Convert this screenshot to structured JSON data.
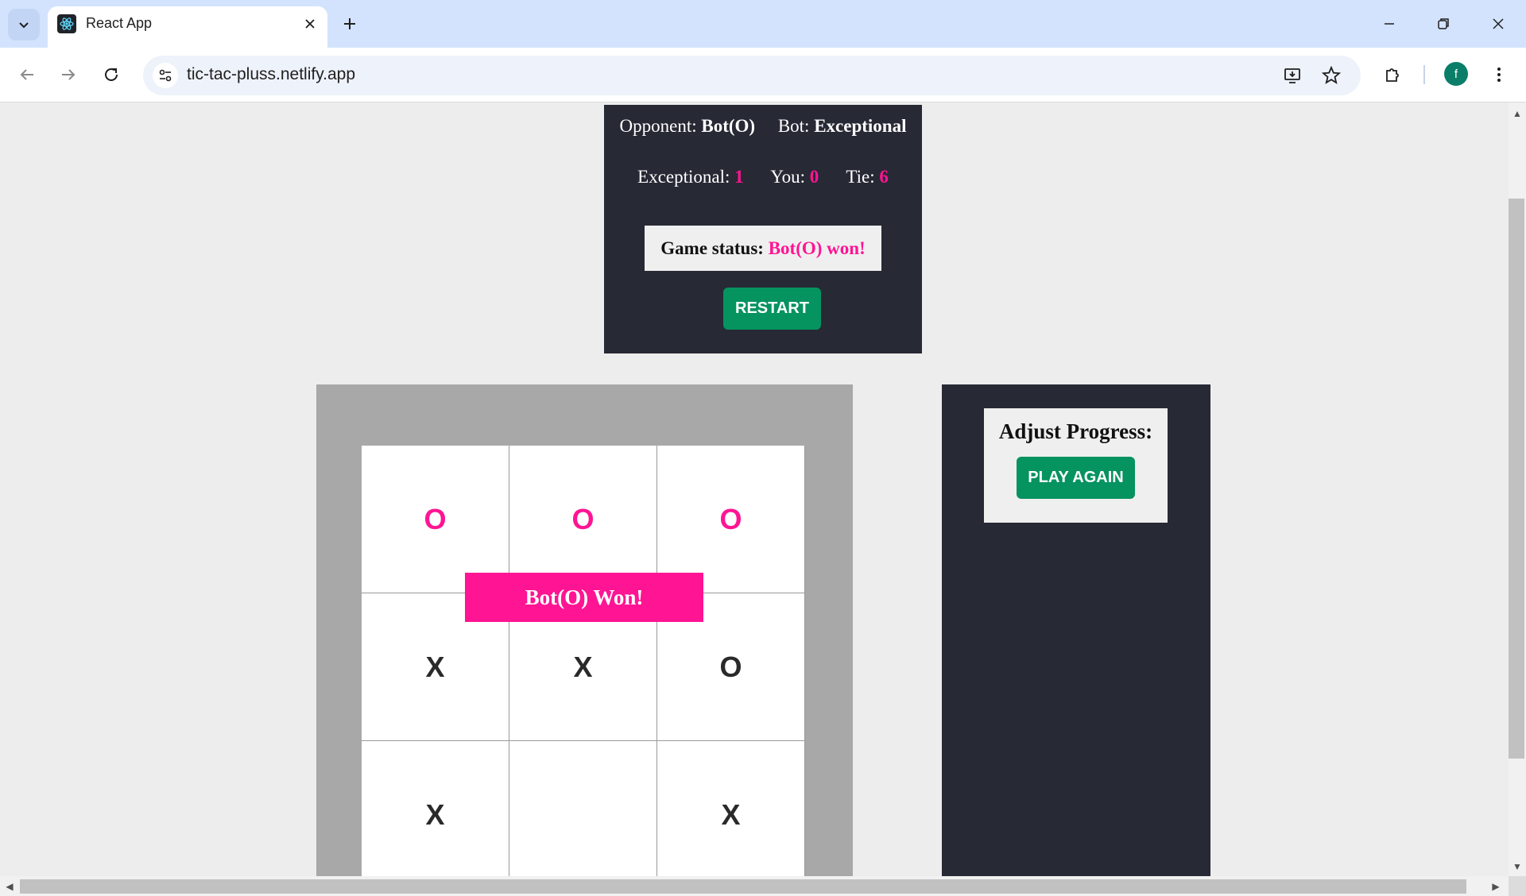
{
  "browser": {
    "tab_title": "React App",
    "url": "tic-tac-pluss.netlify.app",
    "profile_initial": "f",
    "icons": {
      "tab_list": "chevron-down-icon",
      "favicon": "react-icon",
      "tab_close": "close-icon",
      "new_tab": "plus-icon",
      "minimize": "minimize-icon",
      "restore": "restore-icon",
      "close_window": "close-icon",
      "back": "back-arrow-icon",
      "forward": "forward-arrow-icon",
      "reload": "reload-icon",
      "site_info": "tune-icon",
      "install": "install-app-icon",
      "bookmark": "star-icon",
      "extensions": "puzzle-icon",
      "menu": "more-vert-icon"
    }
  },
  "game": {
    "opponent_label": "Opponent:",
    "opponent_value": "Bot(O)",
    "bot_label": "Bot:",
    "bot_value": "Exceptional",
    "score_bot_label": "Exceptional:",
    "score_bot_value": "1",
    "score_you_label": "You:",
    "score_you_value": "0",
    "score_tie_label": "Tie:",
    "score_tie_value": "6",
    "status_label": "Game status:",
    "status_value": "Bot(O) won!",
    "restart_label": "RESTART",
    "winner_banner": "Bot(O) Won!",
    "board": [
      [
        "O",
        "O",
        "O"
      ],
      [
        "X",
        "X",
        "O"
      ],
      [
        "X",
        "",
        "X"
      ]
    ]
  },
  "progress": {
    "title": "Adjust Progress:",
    "play_again_label": "PLAY AGAIN"
  },
  "colors": {
    "accent_pink": "#ff1493",
    "panel_dark": "#272935",
    "button_green": "#05935f",
    "board_frame": "#a8a8a8"
  }
}
